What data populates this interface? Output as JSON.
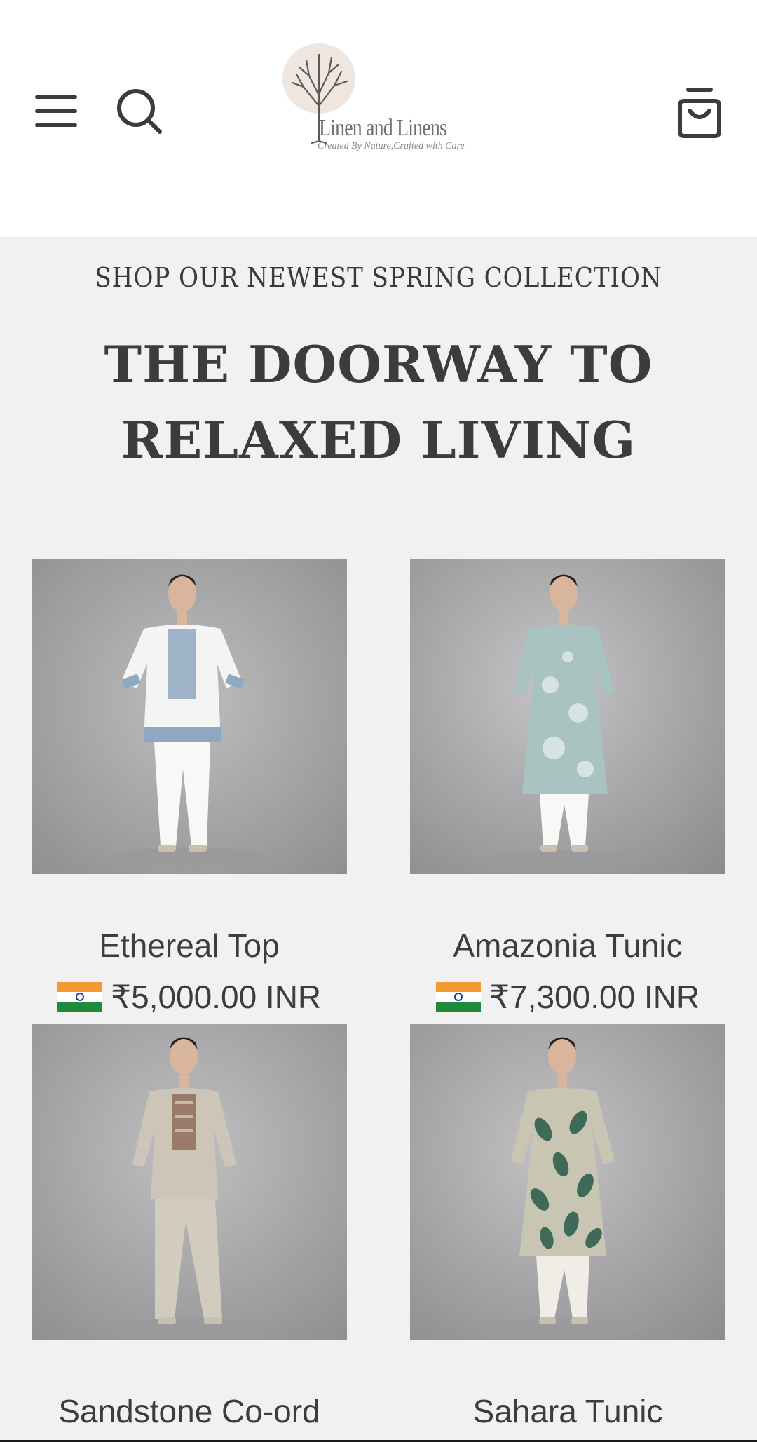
{
  "header": {
    "menu_icon": "hamburger-menu-icon",
    "search_icon": "search-icon",
    "cart_icon": "shopping-bag-icon",
    "logo": {
      "name": "Linen and Linens",
      "tagline": "Created By Nature,Crafted with Care"
    }
  },
  "hero": {
    "eyebrow": "SHOP OUR NEWEST SPRING COLLECTION",
    "headline": "THE DOORWAY TO RELAXED LIVING"
  },
  "products": [
    {
      "title": "Ethereal Top",
      "price": "₹5,000.00 INR",
      "currency_flag": "india-flag-icon",
      "garment_color": "#f4f4f2",
      "accent_color": "#8ea8c4"
    },
    {
      "title": "Amazonia Tunic",
      "price": "₹7,300.00 INR",
      "currency_flag": "india-flag-icon",
      "garment_color": "#a9c3c1",
      "accent_color": "#dfe9e7"
    },
    {
      "title": "Sandstone Co-ord",
      "price": "",
      "currency_flag": "",
      "garment_color": "#cdc6b8",
      "accent_color": "#9a7b6a"
    },
    {
      "title": "Sahara Tunic",
      "price": "",
      "currency_flag": "",
      "garment_color": "#c9c5b3",
      "accent_color": "#3f6a5a"
    }
  ],
  "colors": {
    "page_bg": "#f1f1f2",
    "header_bg": "#ffffff",
    "text": "#3d3d3d",
    "photo_bg": "#a9a9ab"
  }
}
